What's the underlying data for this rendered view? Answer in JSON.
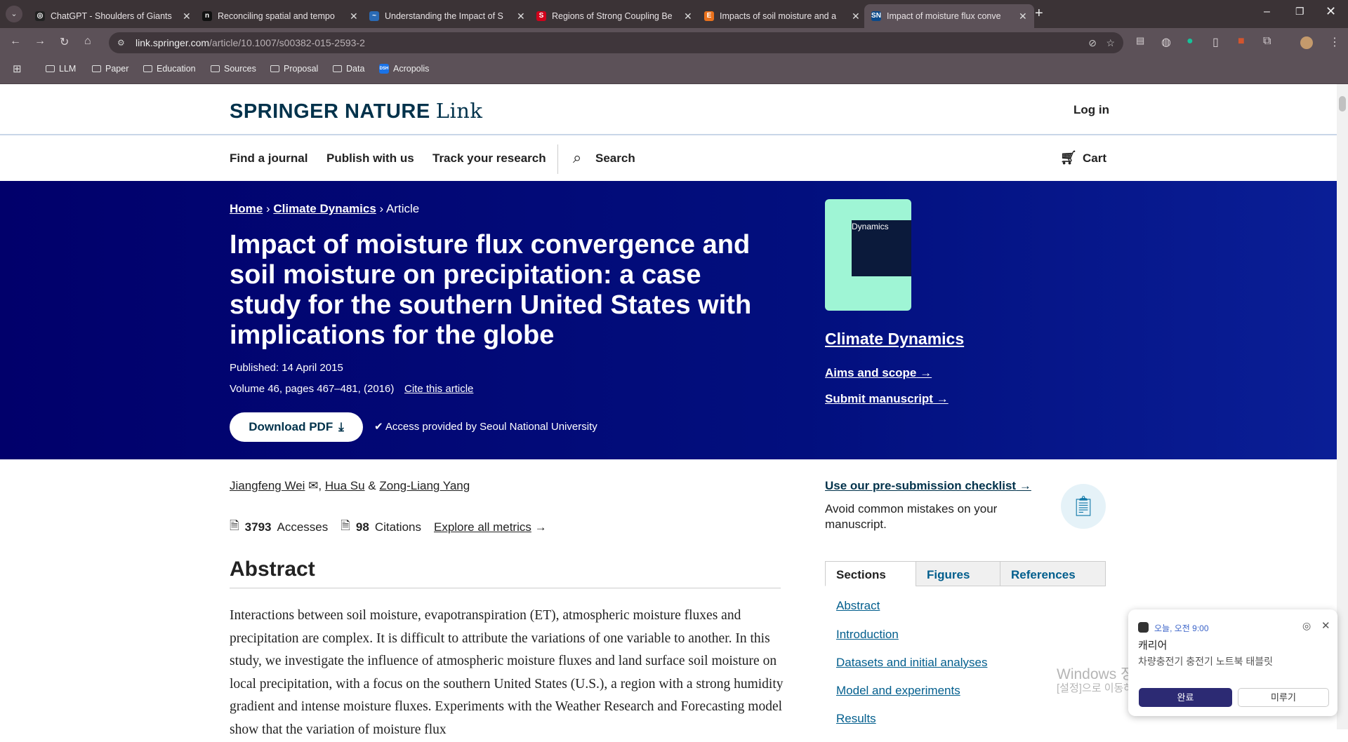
{
  "browser": {
    "tabs": [
      {
        "title": "ChatGPT - Shoulders of Giants",
        "fav": "◎",
        "color": "#222"
      },
      {
        "title": "Reconciling spatial and tempo",
        "fav": "n",
        "color": "#111"
      },
      {
        "title": "Understanding the Impact of S",
        "fav": "~",
        "color": "#2a6ab5"
      },
      {
        "title": "Regions of Strong Coupling Be",
        "fav": "S",
        "color": "#d0021b"
      },
      {
        "title": "Impacts of soil moisture and a",
        "fav": "E",
        "color": "#e9711c"
      },
      {
        "title": "Impact of moisture flux conve",
        "fav": "SN",
        "color": "#0b4a8b"
      }
    ],
    "url_host": "link.springer.com",
    "url_path": "/article/10.1007/s00382-015-2593-2",
    "bookmarks": [
      "LLM",
      "Paper",
      "Education",
      "Sources",
      "Proposal",
      "Data",
      "Acropolis"
    ]
  },
  "header": {
    "logo": "SPRINGER NATURE",
    "logo_link": "Link",
    "login": "Log in",
    "nav": [
      "Find a journal",
      "Publish with us",
      "Track your research",
      "Search",
      "Cart"
    ]
  },
  "hero": {
    "breadcrumb": [
      "Home",
      "Climate Dynamics",
      "Article"
    ],
    "title": "Impact of moisture flux convergence and soil moisture on precipitation: a case study for the southern United States with implications for the globe",
    "published": "Published: 14 April 2015",
    "volume": "Volume 46, pages 467–481, (2016)",
    "cite": "Cite this article",
    "download": "Download PDF",
    "access": "Access provided by Seoul National University",
    "journal": "Climate Dynamics",
    "cover_title": "Dynamics",
    "aims": "Aims and scope",
    "submit": "Submit manuscript"
  },
  "article": {
    "authors": [
      "Jiangfeng Wei",
      "Hua Su",
      "Zong-Liang Yang"
    ],
    "accesses_count": "3793",
    "accesses_label": "Accesses",
    "citations_count": "98",
    "citations_label": "Citations",
    "metrics_link": "Explore all metrics",
    "abstract_heading": "Abstract",
    "abstract": "Interactions between soil moisture, evapotranspiration (ET), atmospheric moisture fluxes and precipitation are complex. It is difficult to attribute the variations of one variable to another. In this study, we investigate the influence of atmospheric moisture fluxes and land surface soil moisture on local precipitation, with a focus on the southern United States (U.S.), a region with a strong humidity gradient and intense moisture fluxes. Experiments with the Weather Research and Forecasting model show that the variation of moisture flux"
  },
  "sidebar": {
    "checklist": "Use our pre-submission checklist",
    "checklist_desc": "Avoid common mistakes on your manuscript.",
    "tabs": [
      "Sections",
      "Figures",
      "References"
    ],
    "sections": [
      "Abstract",
      "Introduction",
      "Datasets and initial analyses",
      "Model and experiments",
      "Results"
    ]
  },
  "notification": {
    "time": "오늘, 오전 9:00",
    "title": "캐리어",
    "body": "차량충전기 충전기 노트북 태블릿",
    "done": "완료",
    "later": "미루기"
  },
  "watermark": {
    "line1": "Windows 정품 인증",
    "line2": "[설정]으로 이동하여 Windows를 정품 인증합니다."
  }
}
